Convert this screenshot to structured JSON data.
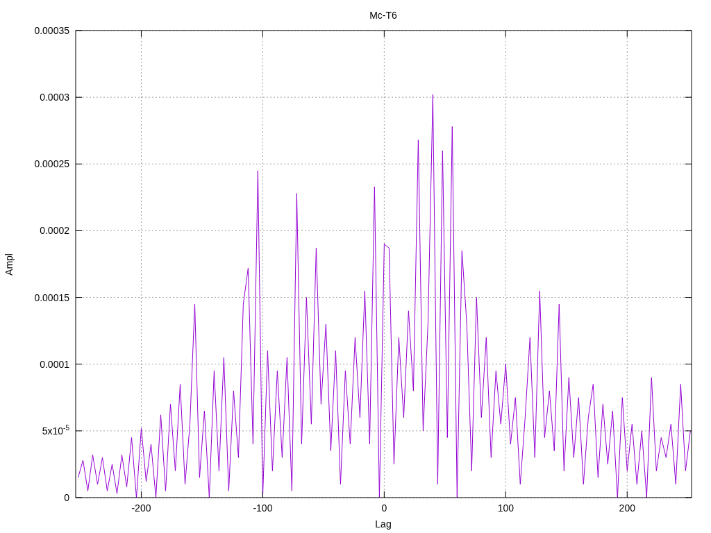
{
  "chart_data": {
    "type": "line",
    "title": "Mc-T6",
    "xlabel": "Lag",
    "ylabel": "Ampl",
    "grid": true,
    "xlim": [
      -254,
      253
    ],
    "ylim": [
      0,
      0.00035
    ],
    "xticks": [
      -200,
      -100,
      0,
      100,
      200
    ],
    "yticks": [
      0,
      {
        "value": 5e-05,
        "label": "5x10$^{-5}$"
      },
      {
        "value": 0.0001,
        "label": "0.0001"
      },
      {
        "value": 0.00015,
        "label": "0.00015"
      },
      {
        "value": 0.0002,
        "label": "0.0002"
      },
      {
        "value": 0.00025,
        "label": "0.00025"
      },
      {
        "value": 0.0003,
        "label": "0.0003"
      },
      {
        "value": 0.00035,
        "label": "0.00035"
      }
    ],
    "x": [
      -252,
      -248,
      -244,
      -240,
      -236,
      -232,
      -228,
      -224,
      -220,
      -216,
      -212,
      -208,
      -204,
      -200,
      -196,
      -192,
      -188,
      -184,
      -180,
      -176,
      -172,
      -168,
      -164,
      -160,
      -156,
      -152,
      -148,
      -144,
      -140,
      -136,
      -132,
      -128,
      -124,
      -120,
      -116,
      -112,
      -108,
      -104,
      -100,
      -96,
      -92,
      -88,
      -84,
      -80,
      -76,
      -72,
      -68,
      -64,
      -60,
      -56,
      -52,
      -48,
      -44,
      -40,
      -36,
      -32,
      -28,
      -24,
      -20,
      -16,
      -12,
      -8,
      -4,
      0,
      4,
      8,
      12,
      16,
      20,
      24,
      28,
      32,
      36,
      40,
      44,
      48,
      52,
      56,
      60,
      64,
      68,
      72,
      76,
      80,
      84,
      88,
      92,
      96,
      100,
      104,
      108,
      112,
      116,
      120,
      124,
      128,
      132,
      136,
      140,
      144,
      148,
      152,
      156,
      160,
      164,
      168,
      172,
      176,
      180,
      184,
      188,
      192,
      196,
      200,
      204,
      208,
      212,
      216,
      220,
      224,
      228,
      232,
      236,
      240,
      244,
      248,
      252
    ],
    "series": [
      {
        "color": "#9400d3",
        "values": [
          1.5e-05,
          2.8e-05,
          5e-06,
          3.2e-05,
          1e-05,
          3e-05,
          5e-06,
          2.5e-05,
          3e-06,
          3.2e-05,
          8e-06,
          4.5e-05,
          0,
          5.2e-05,
          1.2e-05,
          4e-05,
          0,
          6.2e-05,
          5e-06,
          7e-05,
          2e-05,
          8.5e-05,
          1e-05,
          5.5e-05,
          0.000145,
          1.5e-05,
          6.5e-05,
          0,
          9.5e-05,
          2e-05,
          0.000105,
          5e-06,
          8e-05,
          3e-05,
          0.000145,
          0.000172,
          4e-05,
          0.000245,
          0,
          0.00011,
          2e-05,
          9.5e-05,
          3e-05,
          0.000105,
          5e-06,
          0.000228,
          4e-05,
          0.00015,
          5.5e-05,
          0.000187,
          7e-05,
          0.00013,
          3.5e-05,
          0.00011,
          1e-05,
          9.5e-05,
          4e-05,
          0.00012,
          6e-05,
          0.000155,
          4e-05,
          0.000233,
          0,
          0.00019,
          0.000187,
          2.5e-05,
          0.00012,
          6e-05,
          0.00014,
          8e-05,
          0.000268,
          5e-05,
          0.00013,
          0.000302,
          1e-05,
          0.00026,
          4.5e-05,
          0.000278,
          0,
          0.000185,
          0.00013,
          2e-05,
          0.00015,
          6e-05,
          0.00012,
          3e-05,
          9.5e-05,
          5.5e-05,
          0.0001,
          4e-05,
          7.5e-05,
          1e-05,
          6e-05,
          0.00012,
          3e-05,
          0.000155,
          4.5e-05,
          8e-05,
          3.5e-05,
          0.000145,
          2e-05,
          9e-05,
          3e-05,
          7.5e-05,
          1e-05,
          6e-05,
          8.5e-05,
          1.5e-05,
          7e-05,
          2.5e-05,
          6.5e-05,
          0,
          7.5e-05,
          2e-05,
          5.5e-05,
          1e-05,
          5e-05,
          0,
          9e-05,
          2e-05,
          4.5e-05,
          3e-05,
          5.5e-05,
          1e-05,
          8.5e-05,
          2e-05,
          5e-05
        ]
      }
    ]
  }
}
